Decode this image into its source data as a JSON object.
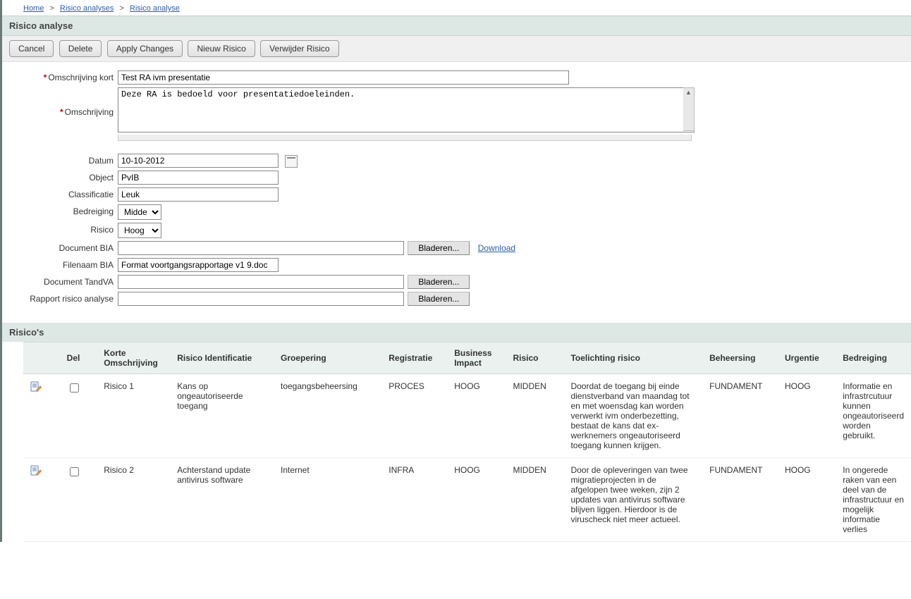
{
  "breadcrumb": {
    "home": "Home",
    "level1": "Risico analyses",
    "level2": "Risico analyse"
  },
  "page_title": "Risico analyse",
  "toolbar": {
    "cancel": "Cancel",
    "delete": "Delete",
    "apply": "Apply Changes",
    "new_risico": "Nieuw Risico",
    "del_risico": "Verwijder Risico"
  },
  "form": {
    "labels": {
      "omschrijving_kort": "Omschrijving kort",
      "omschrijving": "Omschrijving",
      "datum": "Datum",
      "object": "Object",
      "classificatie": "Classificatie",
      "bedreiging": "Bedreiging",
      "risico": "Risico",
      "document_bia": "Document BIA",
      "filenaam_bia": "Filenaam BIA",
      "document_tandva": "Document TandVA",
      "rapport": "Rapport risico analyse"
    },
    "values": {
      "omschrijving_kort": "Test RA ivm presentatie",
      "omschrijving": "Deze RA is bedoeld voor presentatiedoeleinden.",
      "datum": "10-10-2012",
      "object": "PvIB",
      "classificatie": "Leuk",
      "bedreiging": "Midden",
      "risico": "Hoog",
      "document_bia": "",
      "filenaam_bia": "Format voortgangsrapportage v1 9.doc",
      "document_tandva": "",
      "rapport": ""
    },
    "browse_label": "Bladeren...",
    "download_label": "Download"
  },
  "risicos": {
    "title": "Risico's",
    "headers": {
      "del": "Del",
      "korte": "Korte Omschrijving",
      "ident": "Risico Identificatie",
      "groep": "Groepering",
      "reg": "Registratie",
      "bi": "Business Impact",
      "risico": "Risico",
      "toelichting": "Toelichting risico",
      "beheersing": "Beheersing",
      "urgentie": "Urgentie",
      "bedreiging": "Bedreiging"
    },
    "rows": [
      {
        "korte": "Risico 1",
        "ident": "Kans op ongeautoriseerde toegang",
        "groep": "toegangsbeheersing",
        "reg": "PROCES",
        "bi": "HOOG",
        "risico": "MIDDEN",
        "toelichting": "Doordat de toegang bij einde dienstverband van maandag tot en met woensdag kan worden verwerkt ivm onderbezetting, bestaat de kans dat ex-werknemers ongeautoriseerd toegang kunnen krijgen.",
        "beheersing": "FUNDAMENT",
        "urgentie": "HOOG",
        "bedreiging": "Informatie en infrastrcutuur kunnen ongeautoriseerd worden gebruikt."
      },
      {
        "korte": "Risico 2",
        "ident": "Achterstand update antivirus software",
        "groep": "Internet",
        "reg": "INFRA",
        "bi": "HOOG",
        "risico": "MIDDEN",
        "toelichting": "Door de opleveringen van twee migratieprojecten in de afgelopen twee weken, zijn 2 updates van antivirus software blijven liggen. Hierdoor is de viruscheck niet meer actueel.",
        "beheersing": "FUNDAMENT",
        "urgentie": "HOOG",
        "bedreiging": "In ongerede raken van een deel van de infrastructuur en mogelijk informatie verlies"
      }
    ]
  }
}
